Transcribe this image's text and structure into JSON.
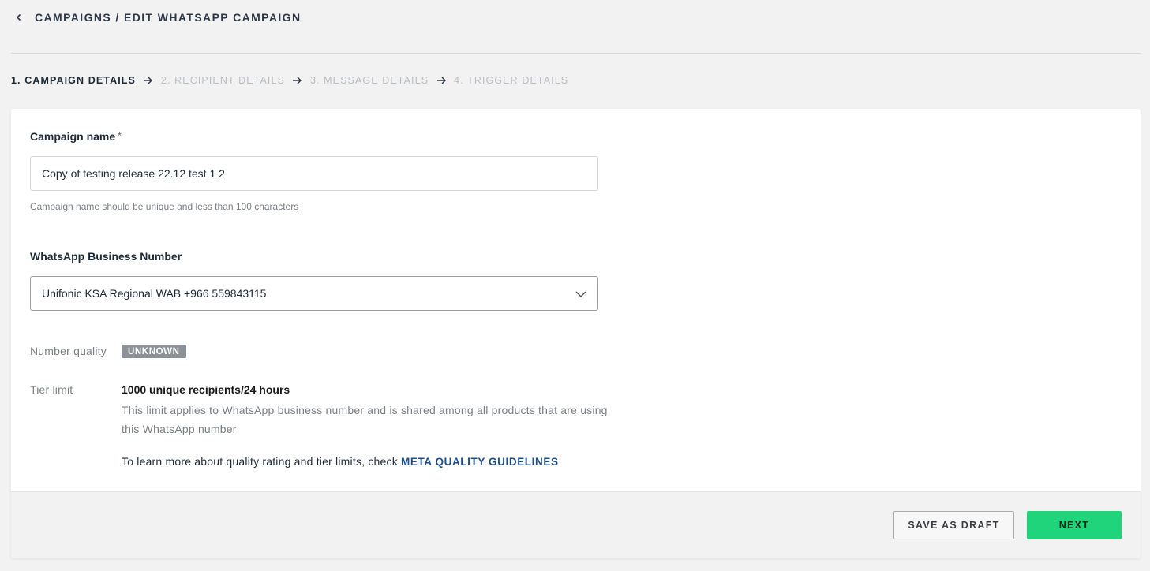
{
  "header": {
    "back_icon": "chevron-left-icon",
    "breadcrumb": "CAMPAIGNS / EDIT WHATSAPP CAMPAIGN"
  },
  "steps": [
    {
      "label": "1. CAMPAIGN DETAILS",
      "active": true
    },
    {
      "label": "2. RECIPIENT DETAILS",
      "active": false
    },
    {
      "label": "3. MESSAGE DETAILS",
      "active": false
    },
    {
      "label": "4. TRIGGER DETAILS",
      "active": false
    }
  ],
  "form": {
    "campaign_name_label": "Campaign name",
    "required_mark": "*",
    "campaign_name_value": "Copy of testing release 22.12 test 1 2",
    "campaign_name_hint": "Campaign name should be unique and less than 100 characters",
    "business_number_label": "WhatsApp Business Number",
    "business_number_value": "Unifonic KSA Regional WAB +966 559843115",
    "number_quality_label": "Number quality",
    "number_quality_badge": "UNKNOWN",
    "tier_limit_label": "Tier limit",
    "tier_limit_value": "1000 unique recipients/24 hours",
    "tier_limit_desc": "This limit applies to WhatsApp business number and is shared among all products that are using this WhatsApp number",
    "learn_more_text": "To learn more about quality rating and tier limits, check ",
    "learn_more_link": "META QUALITY GUIDELINES"
  },
  "footer": {
    "save_draft_label": "SAVE AS DRAFT",
    "next_label": "NEXT"
  },
  "colors": {
    "accent_green": "#1fd47a",
    "link_blue": "#1b4f8c",
    "badge_gray": "#8b9197"
  }
}
